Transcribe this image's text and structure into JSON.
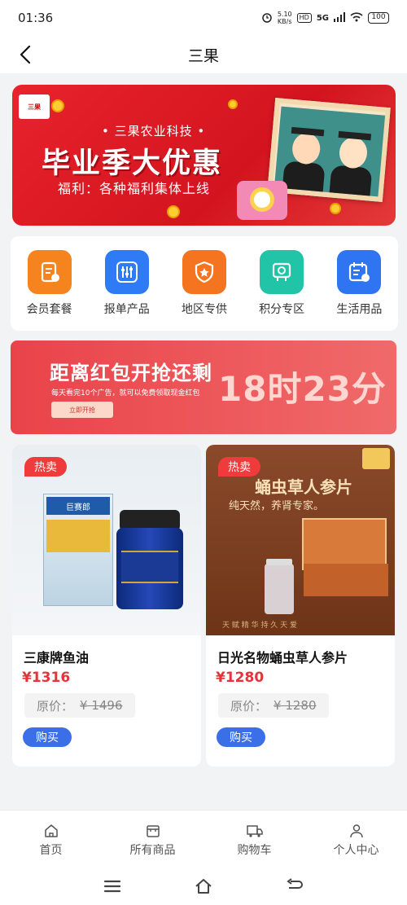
{
  "status": {
    "time": "01:36",
    "net_speed_value": "5.10",
    "net_speed_unit": "KB/s",
    "hd": "HD",
    "network": "5G",
    "battery": "100"
  },
  "nav": {
    "title": "三果"
  },
  "banner": {
    "logo_text": "三果",
    "company": "• 三果农业科技 •",
    "headline": "毕业季大优惠",
    "subline": "福利：各种福利集体上线"
  },
  "categories": [
    {
      "label": "会员套餐",
      "icon": "member-package-icon",
      "color": "#f5841f"
    },
    {
      "label": "报单产品",
      "icon": "sliders-icon",
      "color": "#2f7bf5"
    },
    {
      "label": "地区专供",
      "icon": "shield-star-icon",
      "color": "#f5741f"
    },
    {
      "label": "积分专区",
      "icon": "points-icon",
      "color": "#22c4a8"
    },
    {
      "label": "生活用品",
      "icon": "calendar-yen-icon",
      "color": "#2f74f0"
    }
  ],
  "countdown": {
    "title": "距离红包开抢还剩",
    "subtitle": "每天看完10个广告，就可以免费领取现金红包",
    "button": "立即开抢",
    "time": "18时23分"
  },
  "products": [
    {
      "badge": "热卖",
      "name": "三康牌鱼油",
      "price": "¥1316",
      "orig_label": "原价：",
      "orig_value": "¥ 1496",
      "buy": "购买",
      "image_title": "巨赛郎"
    },
    {
      "badge": "热卖",
      "name": "日光名物蛹虫草人参片",
      "price": "¥1280",
      "orig_label": "原价：",
      "orig_value": "¥ 1280",
      "buy": "购买",
      "image_title": "蛹虫草人参片",
      "image_subtitle": "纯天然，养肾专家。",
      "image_footer": "天 赋 精 华   持 久 天 爱"
    }
  ],
  "tabs": [
    {
      "label": "首页",
      "icon": "home-icon"
    },
    {
      "label": "所有商品",
      "icon": "store-icon"
    },
    {
      "label": "购物车",
      "icon": "truck-icon"
    },
    {
      "label": "个人中心",
      "icon": "person-icon"
    }
  ]
}
